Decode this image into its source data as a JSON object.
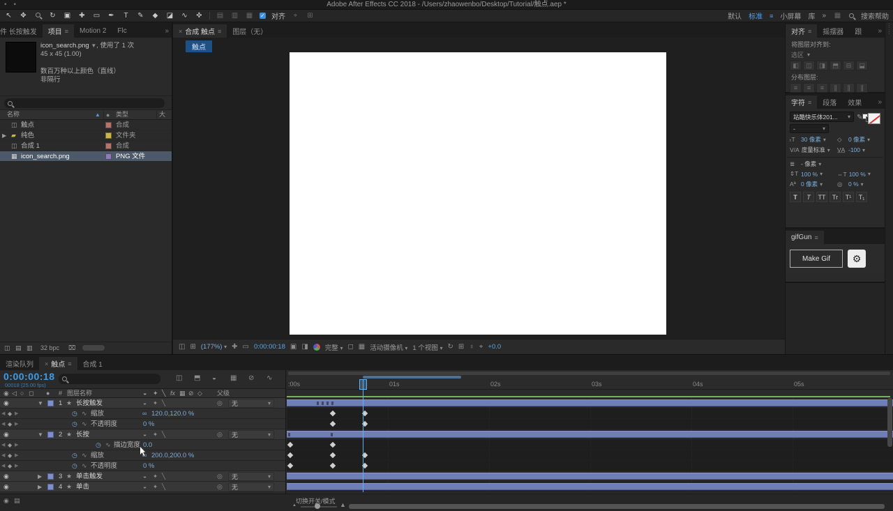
{
  "colors": {
    "accent_blue": "#3f96f0",
    "value_blue": "#7cacdc",
    "time_blue": "#3f9be4",
    "layer_bar": "#6f7fb6",
    "cache_green": "#7fae5a",
    "selection": "#4c5968"
  },
  "titlebar": {
    "title": "Adobe After Effects CC 2018 - /Users/zhaowenbo/Desktop/Tutorial/触点.aep *"
  },
  "toolbar": {
    "snap_label": "对齐",
    "ws_default": "默认",
    "ws_standard": "标准",
    "ws_small": "小屏幕",
    "ws_library": "库",
    "search_help": "搜索帮助"
  },
  "project": {
    "tab_effect_controls": "件 长按触发",
    "tab_project": "项目",
    "tab_motion": "Motion 2",
    "tab_flow": "Flc",
    "preview_name": "icon_search.png",
    "preview_usage": ", 使用了 1 次",
    "preview_dims": "45 x 45 (1.00)",
    "preview_color": "数百万种以上颜色（直线）",
    "preview_scan": "非隔行",
    "col_name": "名称",
    "col_type": "类型",
    "col_size": "大",
    "items": [
      {
        "name": "触点",
        "type": "合成"
      },
      {
        "name": "纯色",
        "type": "文件夹"
      },
      {
        "name": "合成 1",
        "type": "合成"
      },
      {
        "name": "icon_search.png",
        "type": "PNG 文件"
      }
    ],
    "bpc": "32 bpc"
  },
  "comp": {
    "tab_comp": "合成 触点",
    "tab_layer": "图层（无）",
    "chip": "触点",
    "zoom": "(177%)",
    "time": "0:00:00:18",
    "resolution": "完整",
    "camera": "活动摄像机",
    "views": "1 个视图",
    "exposure": "+0.0"
  },
  "align": {
    "tab_align": "对齐",
    "tab_wiggler": "摇摆器",
    "tab_tracker": "跟",
    "align_to": "将图层对齐到:",
    "align_to_value": "选区",
    "distribute": "分布图层:"
  },
  "character": {
    "tab_character": "字符",
    "tab_paragraph": "段落",
    "tab_effects": "效果",
    "font_family": "站酷快乐体201...",
    "font_style": "-",
    "font_size": "30 像素",
    "kern_value": "0 像素",
    "metrics": "度量标准",
    "tracking": "-100",
    "leading": "- 像素",
    "v_scale": "100 %",
    "h_scale": "100 %",
    "baseline": "0 像素",
    "tsume": "0 %",
    "styles": [
      "T",
      "T",
      "TT",
      "Tr",
      "T¹",
      "T₁"
    ]
  },
  "gifgun": {
    "title": "gifGun",
    "make_gif": "Make Gif"
  },
  "timeline": {
    "tab_render": "渲染队列",
    "tab_comp": "触点",
    "tab_comp1": "合成 1",
    "time": "0:00:00:18",
    "frames": "00018 (25.00 fps)",
    "col_num": "#",
    "col_layer": "图层名称",
    "col_parent": "父级",
    "ruler": [
      ":00s",
      "01s",
      "02s",
      "03s",
      "04s",
      "05s"
    ],
    "rows": [
      {
        "num": "1",
        "name": "长按触发",
        "parent": "无"
      },
      {
        "name": "缩放",
        "value": "120.0,120.0 %"
      },
      {
        "name": "不透明度",
        "value": "0 %"
      },
      {
        "num": "2",
        "name": "长按",
        "parent": "无"
      },
      {
        "name": "描边宽度",
        "value": "0.0"
      },
      {
        "name": "缩放",
        "value": "200.0,200.0 %"
      },
      {
        "name": "不透明度",
        "value": "0 %"
      },
      {
        "num": "3",
        "name": "单击触发",
        "parent": "无"
      },
      {
        "num": "4",
        "name": "单击",
        "parent": "无"
      }
    ],
    "toggle_modes": "切换开关/模式"
  }
}
